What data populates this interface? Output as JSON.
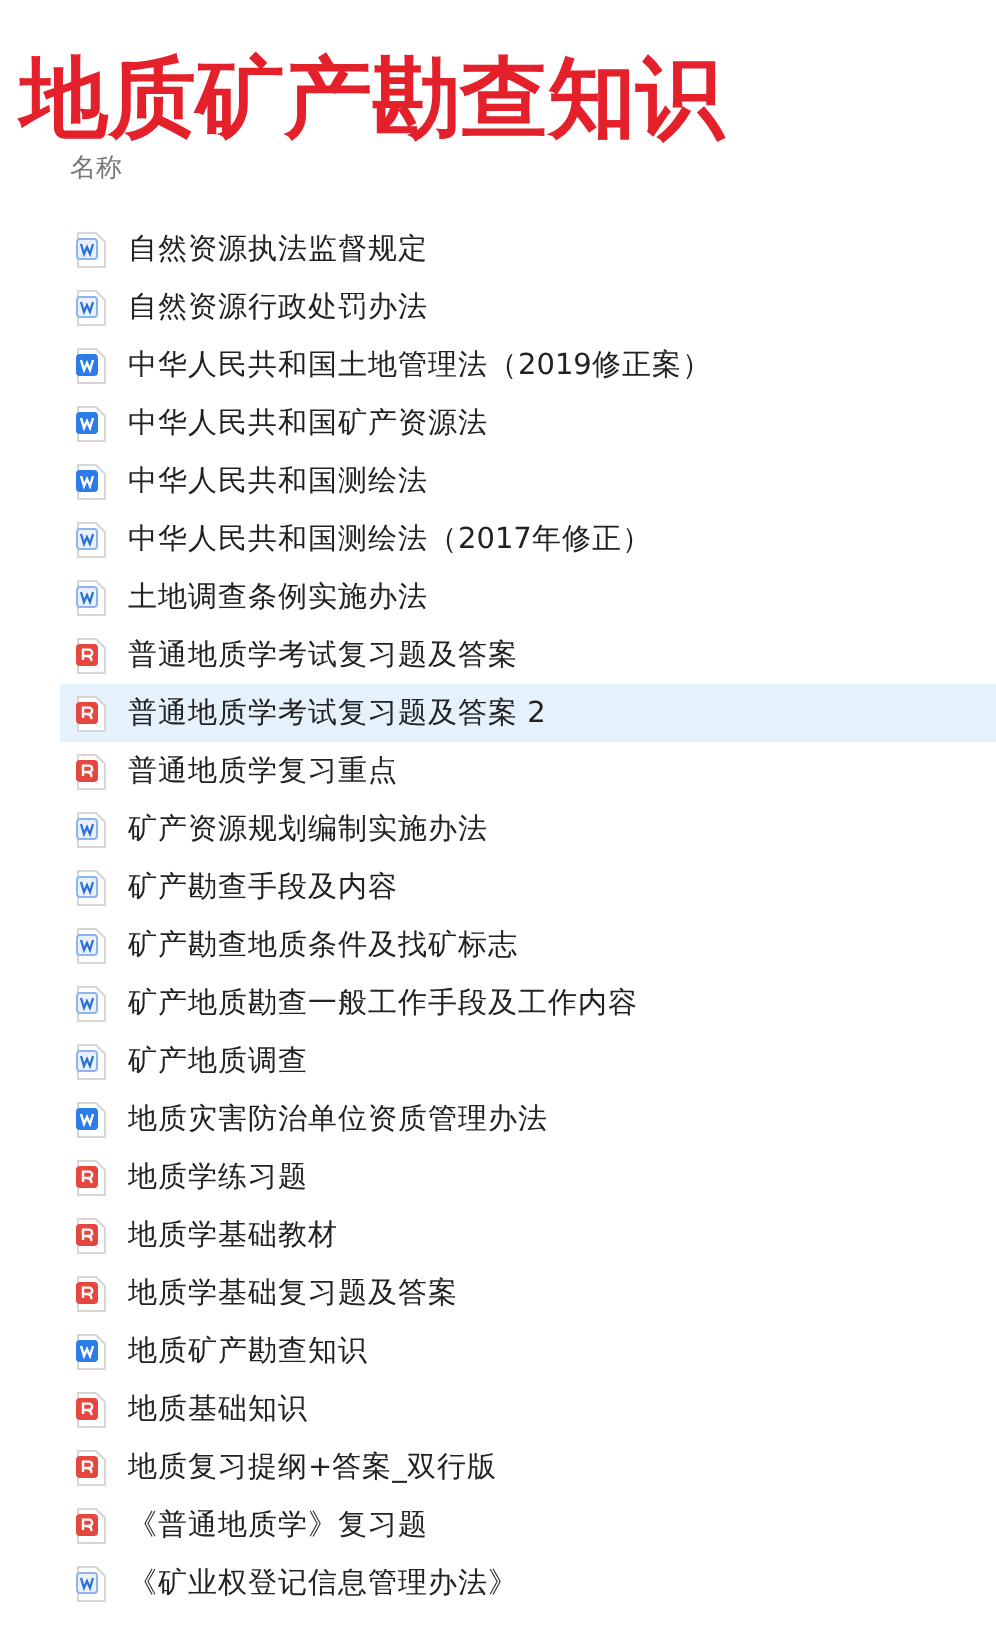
{
  "title": "地质矿产勘查知识",
  "column_header": "名称",
  "files": [
    {
      "name": "自然资源执法监督规定",
      "kind": "doc",
      "selected": false
    },
    {
      "name": "自然资源行政处罚办法",
      "kind": "doc",
      "selected": false
    },
    {
      "name": "中华人民共和国土地管理法（2019修正案）",
      "kind": "docx",
      "selected": false
    },
    {
      "name": "中华人民共和国矿产资源法",
      "kind": "docx",
      "selected": false
    },
    {
      "name": "中华人民共和国测绘法",
      "kind": "docx",
      "selected": false
    },
    {
      "name": "中华人民共和国测绘法（2017年修正）",
      "kind": "doc",
      "selected": false
    },
    {
      "name": "土地调查条例实施办法",
      "kind": "doc",
      "selected": false
    },
    {
      "name": "普通地质学考试复习题及答案",
      "kind": "pdf",
      "selected": false
    },
    {
      "name": "普通地质学考试复习题及答案 2",
      "kind": "pdf",
      "selected": true
    },
    {
      "name": "普通地质学复习重点",
      "kind": "pdf",
      "selected": false
    },
    {
      "name": "矿产资源规划编制实施办法",
      "kind": "doc",
      "selected": false
    },
    {
      "name": "矿产勘查手段及内容",
      "kind": "doc",
      "selected": false
    },
    {
      "name": "矿产勘查地质条件及找矿标志",
      "kind": "doc",
      "selected": false
    },
    {
      "name": "矿产地质勘查一般工作手段及工作内容",
      "kind": "doc",
      "selected": false
    },
    {
      "name": "矿产地质调查",
      "kind": "doc",
      "selected": false
    },
    {
      "name": "地质灾害防治单位资质管理办法",
      "kind": "docx",
      "selected": false
    },
    {
      "name": "地质学练习题",
      "kind": "pdf",
      "selected": false
    },
    {
      "name": "地质学基础教材",
      "kind": "pdf",
      "selected": false
    },
    {
      "name": "地质学基础复习题及答案",
      "kind": "pdf",
      "selected": false
    },
    {
      "name": "地质矿产勘查知识",
      "kind": "docx",
      "selected": false
    },
    {
      "name": "地质基础知识",
      "kind": "pdf",
      "selected": false
    },
    {
      "name": "地质复习提纲+答案_双行版",
      "kind": "pdf",
      "selected": false
    },
    {
      "name": "《普通地质学》复习题",
      "kind": "pdf",
      "selected": false
    },
    {
      "name": "《矿业权登记信息管理办法》",
      "kind": "doc",
      "selected": false
    }
  ]
}
